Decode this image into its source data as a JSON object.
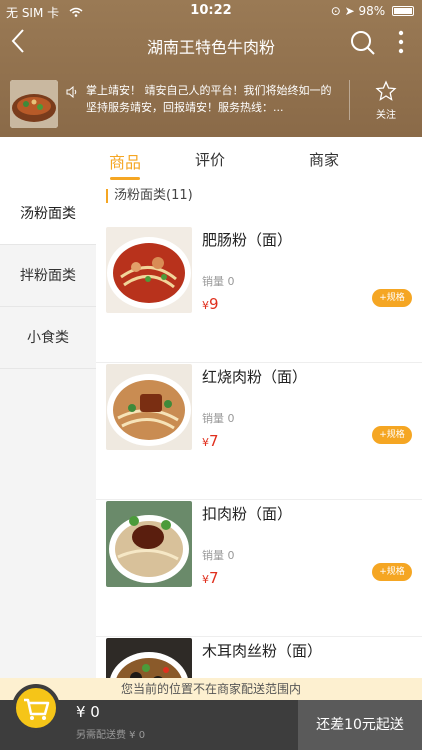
{
  "status_bar": {
    "carrier": "无 SIM 卡",
    "time": "10:22",
    "battery": "98%"
  },
  "nav": {
    "title": "湖南王特色牛肉粉"
  },
  "shop": {
    "notice": "掌上靖安！ 靖安自己人的平台！我们将始终如一的坚持服务靖安，回报靖安！服务热线：...",
    "follow_label": "关注"
  },
  "tabs": [
    {
      "label": "商品",
      "active": true
    },
    {
      "label": "评价",
      "active": false
    },
    {
      "label": "商家",
      "active": false
    }
  ],
  "sidebar": {
    "items": [
      {
        "label": "汤粉面类",
        "active": true
      },
      {
        "label": "拌粉面类",
        "active": false
      },
      {
        "label": "小食类",
        "active": false
      }
    ]
  },
  "section": {
    "title": "汤粉面类(11)"
  },
  "products": [
    {
      "name": "肥肠粉（面）",
      "sales": "销量 0",
      "price_symbol": "¥",
      "price": "9",
      "spec_label": "+规格"
    },
    {
      "name": "红烧肉粉（面）",
      "sales": "销量 0",
      "price_symbol": "¥",
      "price": "7",
      "spec_label": "+规格"
    },
    {
      "name": "扣肉粉（面）",
      "sales": "销量 0",
      "price_symbol": "¥",
      "price": "7",
      "spec_label": "+规格"
    },
    {
      "name": "木耳肉丝粉（面）"
    }
  ],
  "delivery_notice": "您当前的位置不在商家配送范围内",
  "cart": {
    "total": "¥ 0",
    "delivery_fee": "另需配送费 ¥ 0",
    "checkout_label": "还差10元起送"
  },
  "colors": {
    "accent": "#f5a623",
    "price": "#e0301e",
    "header_bg": "#9a7a55"
  }
}
